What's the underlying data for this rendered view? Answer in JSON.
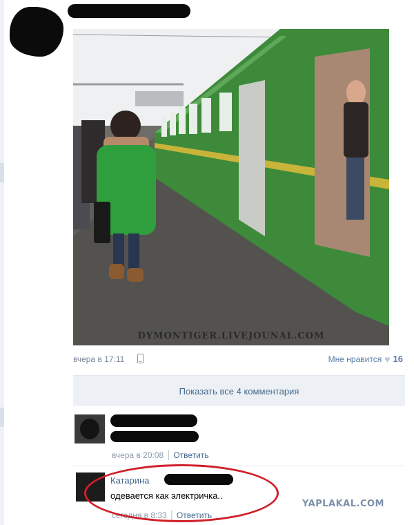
{
  "post": {
    "photo_watermark": "DYMONTIGER.LIVEJOUNAL.COM",
    "time": "вчера в 17:11",
    "like_label": "Мне нравится",
    "like_count": "16",
    "show_comments_label": "Показать все 4 комментария"
  },
  "comments": [
    {
      "date": "вчера в 20:08",
      "reply_label": "Ответить"
    },
    {
      "author": "Катарина",
      "text": "одевается как электричка..",
      "date": "сегодня в 8:33",
      "reply_label": "Ответить"
    }
  ],
  "site_logo": "YAPLAKAL.COM",
  "colors": {
    "link": "#45688e",
    "annotation_circle": "#d0202a",
    "jacket": "#2f9e3c",
    "train": "#3d8a3a"
  }
}
